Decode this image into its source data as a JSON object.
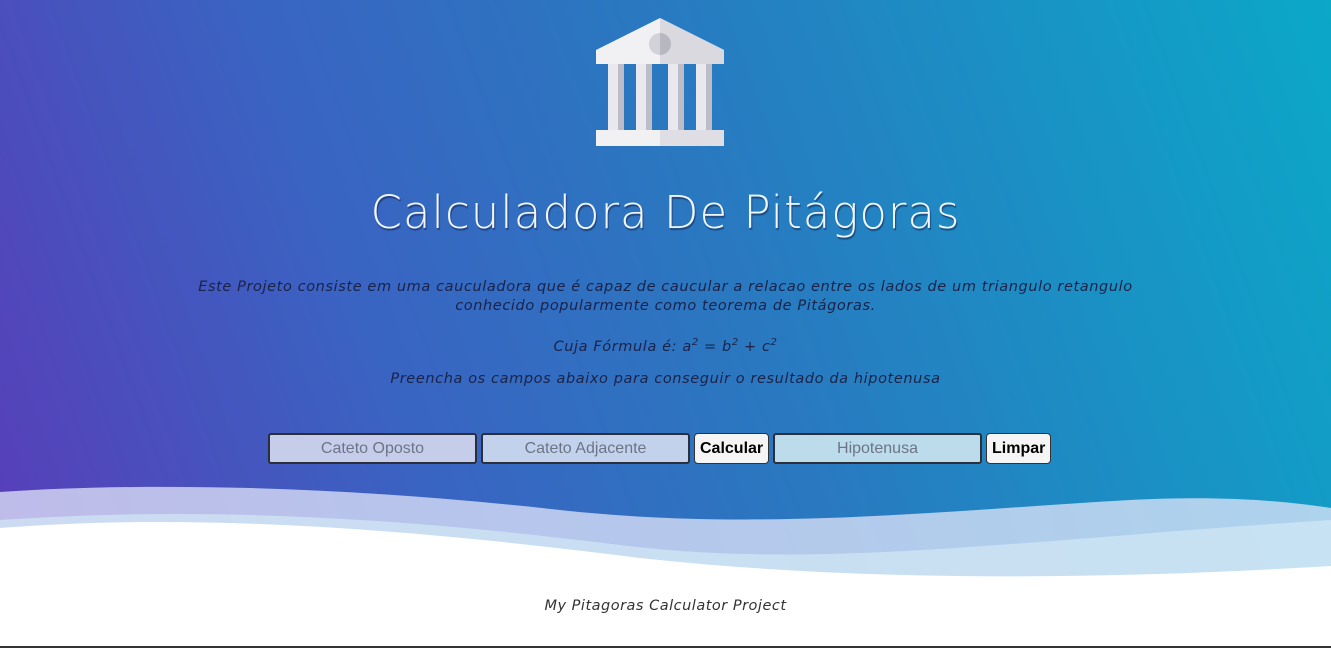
{
  "header": {
    "logo_icon": "bank-building-icon",
    "title": "Calculadora De Pitágoras"
  },
  "description": {
    "line1": "Este Projeto consiste em uma cauculadora que é capaz de caucular a relacao entre os lados de um triangulo retangulo",
    "line2": "conhecido popularmente como teorema de Pitágoras.",
    "formula_prefix": "Cuja Fórmula é: ",
    "formula_a": "a",
    "formula_b": "b",
    "formula_c": "c",
    "formula_exp": "2",
    "formula_eq": " = ",
    "formula_plus": " + ",
    "instructions": "Preencha os campos abaixo para conseguir o resultado da hipotenusa"
  },
  "form": {
    "cateto_oposto": {
      "placeholder": "Cateto Oposto",
      "value": ""
    },
    "cateto_adjacente": {
      "placeholder": "Cateto Adjacente",
      "value": ""
    },
    "calcular_label": "Calcular",
    "hipotenusa": {
      "placeholder": "Hipotenusa",
      "value": ""
    },
    "limpar_label": "Limpar"
  },
  "footer": {
    "text": "My Pitagoras Calculator Project"
  },
  "colors": {
    "gradient_start": "#5a3bb8",
    "gradient_end": "#0ba8c8",
    "title_text": "#f2f6ff"
  }
}
